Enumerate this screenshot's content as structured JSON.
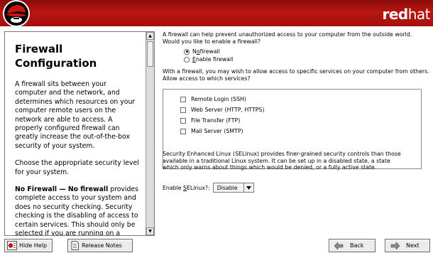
{
  "banner": {
    "brand_bold": "red",
    "brand_normal": "hat"
  },
  "help": {
    "title": "Firewall Configuration",
    "paragraphs": [
      "A firewall sits between your computer and the network, and determines which resources on your computer remote users on the network are able to access. A properly configured firewall can greatly increase the out-of-the-box security of your system.",
      "Choose the appropriate security level for your system."
    ],
    "no_firewall_heading": "No Firewall — No firewall",
    "no_firewall_text": " provides complete access to your system and does no security checking. Security checking is the disabling of access to certain services. This should only be selected if you are running on a trusted"
  },
  "firewall": {
    "intro": "A firewall can help prevent unauthorized access to your computer from the outside world.  Would you like to enable a firewall?",
    "options": [
      {
        "label_prefix": "N",
        "label_mnemonic": "o",
        "label_suffix": " firewall",
        "selected": true
      },
      {
        "label_prefix": "",
        "label_mnemonic": "E",
        "label_suffix": "nable firewall",
        "selected": false
      }
    ],
    "services_intro": "With a firewall, you may wish to allow access to specific services on your computer from others.  Allow access to which services?",
    "services": [
      {
        "label": "Remote Login (SSH)",
        "checked": false
      },
      {
        "label": "Web Server (HTTP, HTTPS)",
        "checked": false
      },
      {
        "label": "File Transfer (FTP)",
        "checked": false
      },
      {
        "label": "Mail Server (SMTP)",
        "checked": false
      }
    ]
  },
  "selinux": {
    "description": "Security Enhanced Linux (SELinux) provides finer-grained security controls than those available in a traditional Linux system.  It can be set up in a disabled state, a state which only warns about things which would be denied, or a fully active state.",
    "label_prefix": "Enable ",
    "label_mnemonic": "S",
    "label_suffix": "ELinux?:",
    "selected": "Disable"
  },
  "buttons": {
    "hide_help": "Hide Help",
    "release_notes": "Release Notes",
    "back": "Back",
    "next": "Next"
  },
  "icons": {
    "logo": "redhat-shadowman-logo",
    "hide_help": "help-icon",
    "release_notes": "document-icon",
    "back": "arrow-left-icon",
    "next": "arrow-right-icon"
  },
  "colors": {
    "banner_red": "#b81612"
  }
}
